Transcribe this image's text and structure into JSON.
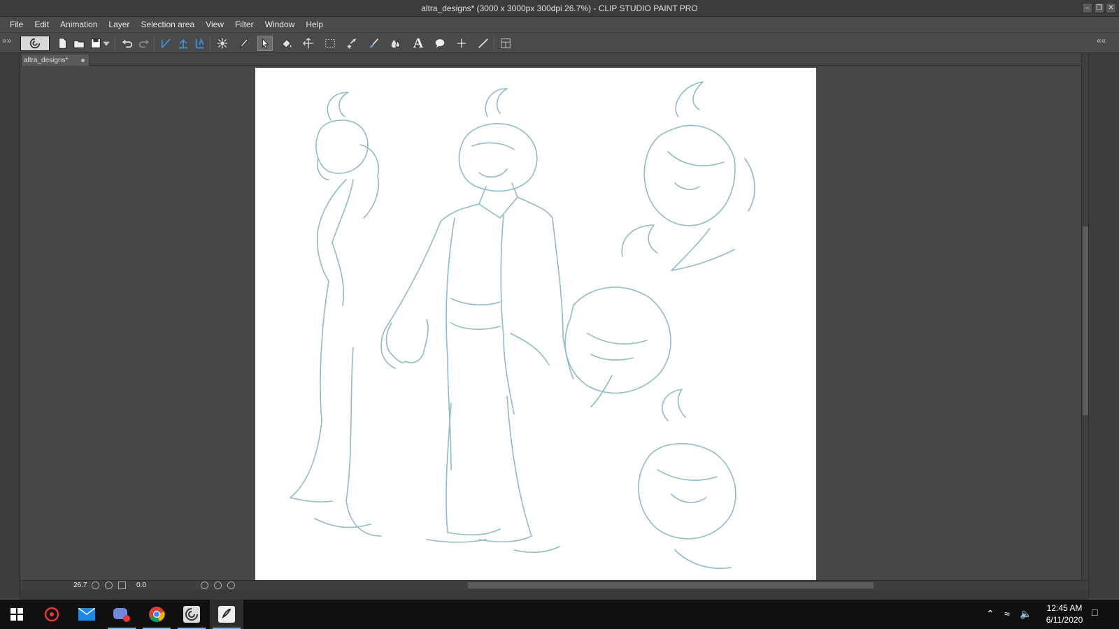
{
  "window": {
    "title": "altra_designs* (3000 x 3000px 300dpi 26.7%)  - CLIP STUDIO PAINT PRO",
    "buttons": [
      "minimize",
      "restore",
      "close"
    ]
  },
  "menubar": {
    "items": [
      "File",
      "Edit",
      "Animation",
      "Layer",
      "Selection area",
      "View",
      "Filter",
      "Window",
      "Help"
    ]
  },
  "toolbar": {
    "tools": [
      "clip-studio-icon",
      "new-file-icon",
      "open-file-icon",
      "save-icon",
      "save-dropdown-icon",
      "undo-icon",
      "redo-icon",
      "ruler-snap-icon",
      "special-ruler-snap-icon",
      "grid-snap-icon",
      "zoom-tool-icon",
      "pen-tool-icon",
      "select-layer-icon",
      "fill-tool-icon",
      "move-layer-icon",
      "rect-selection-icon",
      "operation-icon",
      "brush-tool-icon",
      "blend-tool-icon",
      "text-tool-icon",
      "balloon-tool-icon",
      "ruler-tool-icon",
      "line-tool-icon",
      "layout-icon"
    ]
  },
  "document": {
    "tab_label": "altra_designs*",
    "zoom": "26.7",
    "rotation": "0.0"
  },
  "taskbar": {
    "apps": [
      "windows-start-icon",
      "antivirus-icon",
      "mail-icon",
      "discord-icon",
      "chrome-icon",
      "clip-studio-icon",
      "clip-studio-paint-icon"
    ],
    "time": "12:45 AM",
    "date": "6/11/2020"
  },
  "colors": {
    "sketch": "#8fbcc8",
    "ui_dark": "#474747",
    "taskbar": "#101010"
  }
}
